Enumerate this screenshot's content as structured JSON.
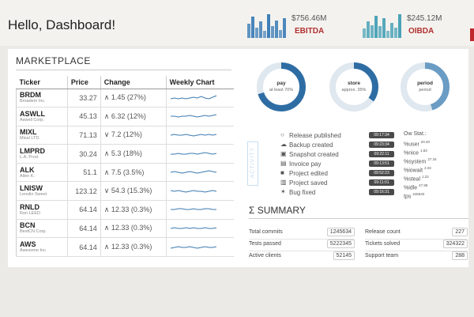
{
  "header": {
    "title": "Hello, Dashboard!",
    "kpis": [
      {
        "value": "$756.46M",
        "label": "EBITDA",
        "bar_heights": [
          0.6,
          0.9,
          0.45,
          0.7,
          0.3,
          1.0,
          0.5,
          0.75,
          0.35,
          0.85
        ],
        "bar_color": "#3f7fb8"
      },
      {
        "value": "$245.12M",
        "label": "OIBDA",
        "bar_heights": [
          0.4,
          0.7,
          0.55,
          0.95,
          0.5,
          0.85,
          0.3,
          0.65,
          0.45,
          1.0
        ],
        "bar_color": "#4aa3b8"
      }
    ]
  },
  "marketplace": {
    "title": "MARKETPLACE",
    "columns": [
      "Ticker",
      "Price",
      "Change",
      "Weekly Chart"
    ],
    "rows": [
      {
        "symbol": "BRDM",
        "company": "Broadem Inc.",
        "price": "33.27",
        "change": "∧ 1.45 (27%)",
        "spark": [
          5,
          6,
          5,
          6,
          5,
          6,
          7,
          6,
          8,
          6,
          5,
          7,
          9
        ]
      },
      {
        "symbol": "ASWLL",
        "company": "Aswell Corp.",
        "price": "45.13",
        "change": "∧ 6.32 (12%)",
        "spark": [
          6,
          6,
          5,
          6,
          6,
          7,
          6,
          5,
          6,
          7,
          6,
          7,
          8
        ]
      },
      {
        "symbol": "MIXL",
        "company": "Mixal LTD.",
        "price": "71.13",
        "change": "∨ 7.2 (12%)",
        "spark": [
          6,
          7,
          6,
          6,
          7,
          6,
          5,
          6,
          7,
          6,
          7,
          6,
          7
        ]
      },
      {
        "symbol": "LMPRD",
        "company": "L.A. Prod.",
        "price": "30.24",
        "change": "∧ 5.3 (18%)",
        "spark": [
          6,
          6,
          7,
          6,
          6,
          7,
          7,
          6,
          7,
          8,
          7,
          6,
          7
        ]
      },
      {
        "symbol": "ALK",
        "company": "Allen K.",
        "price": "51.1",
        "change": "∧ 7.5 (3.5%)",
        "spark": [
          6,
          7,
          6,
          5,
          6,
          7,
          6,
          5,
          6,
          7,
          8,
          7,
          6
        ]
      },
      {
        "symbol": "LNISW",
        "company": "Lenslin Sweet",
        "price": "123.12",
        "change": "∨ 54.3 (15.3%)",
        "spark": [
          7,
          6,
          7,
          6,
          5,
          6,
          7,
          6,
          6,
          5,
          6,
          7,
          6
        ]
      },
      {
        "symbol": "RNLD",
        "company": "Ron LEED",
        "price": "64.14",
        "change": "∧ 12.33 (0.3%)",
        "spark": [
          6,
          6,
          7,
          7,
          6,
          6,
          7,
          6,
          6,
          7,
          7,
          6,
          6
        ]
      },
      {
        "symbol": "BCN",
        "company": "BestCN Corp.",
        "price": "64.14",
        "change": "∧ 12.33 (0.3%)",
        "spark": [
          6,
          7,
          6,
          6,
          7,
          6,
          7,
          6,
          6,
          7,
          6,
          6,
          7
        ]
      },
      {
        "symbol": "AWS",
        "company": "Awesome Inc.",
        "price": "64.14",
        "change": "∧ 12.33 (0.3%)",
        "spark": [
          5,
          6,
          7,
          6,
          6,
          7,
          6,
          5,
          6,
          7,
          6,
          6,
          7
        ]
      }
    ]
  },
  "donuts": [
    {
      "title": "pay",
      "subtitle": "at least 70%",
      "fraction": 0.7,
      "color": "#2e6da4"
    },
    {
      "title": "store",
      "subtitle": "approx. 35%",
      "fraction": 0.35,
      "color": "#2e6da4"
    },
    {
      "title": "period",
      "subtitle": "period",
      "fraction": 0.45,
      "color": "#6a9cc4"
    }
  ],
  "activity": {
    "label": "ACTIVITY",
    "items": [
      {
        "icon": "○",
        "icon_name": "release-icon",
        "text": "Release published",
        "time": "09:17:34"
      },
      {
        "icon": "☁",
        "icon_name": "backup-icon",
        "text": "Backup created",
        "time": "09:23:34"
      },
      {
        "icon": "▣",
        "icon_name": "snapshot-icon",
        "text": "Snapshot created",
        "time": "09:22:11"
      },
      {
        "icon": "▤",
        "icon_name": "invoice-icon",
        "text": "Invoice pay",
        "time": "09:13:51"
      },
      {
        "icon": "■",
        "icon_name": "project-edit-icon",
        "text": "Project edited",
        "time": "09:52:23"
      },
      {
        "icon": "▥",
        "icon_name": "project-save-icon",
        "text": "Project saved",
        "time": "09:11:01"
      },
      {
        "icon": "✶",
        "icon_name": "bug-icon",
        "text": "Bug fixed",
        "time": "09:16:31"
      }
    ],
    "stats_title": "Ow Stat.:",
    "stats": [
      {
        "label": "%user",
        "value": "20.40"
      },
      {
        "label": "%nice",
        "value": "1.83"
      },
      {
        "label": "%system",
        "value": "27.34"
      },
      {
        "label": "%iowait",
        "value": "2.02"
      },
      {
        "label": "%steal",
        "value": "1.22"
      },
      {
        "label": "%idle",
        "value": "47.98"
      },
      {
        "label": "tps",
        "value": "246540"
      }
    ]
  },
  "summary": {
    "title": "Σ SUMMARY",
    "left": [
      {
        "label": "Total commits",
        "value": "1245634"
      },
      {
        "label": "Tests passed",
        "value": "5222345"
      },
      {
        "label": "Active clients",
        "value": "52145"
      }
    ],
    "right": [
      {
        "label": "Release count",
        "value": "227"
      },
      {
        "label": "Tickets solved",
        "value": "324322"
      },
      {
        "label": "Support team",
        "value": "288"
      }
    ]
  }
}
